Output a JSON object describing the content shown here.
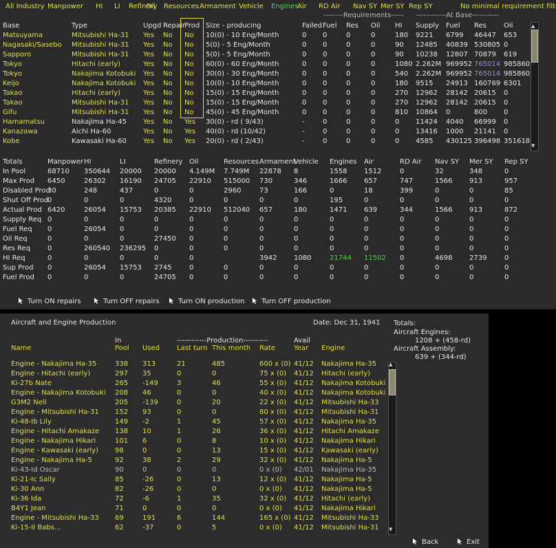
{
  "filters": [
    {
      "label": "All Industry",
      "color": "#e2e23a"
    },
    {
      "label": "Manpower",
      "color": "#e2e23a"
    },
    {
      "label": "HI",
      "color": "#e2e23a"
    },
    {
      "label": "LI",
      "color": "#e2e23a"
    },
    {
      "label": "Refinery",
      "color": "#e2e23a"
    },
    {
      "label": "Oil",
      "color": "#e2e23a"
    },
    {
      "label": "Resources",
      "color": "#e2e23a"
    },
    {
      "label": "Armament",
      "color": "#e2e23a"
    },
    {
      "label": "Vehicle",
      "color": "#e2e23a"
    },
    {
      "label": "Engines",
      "color": "#3ae03a"
    },
    {
      "label": "Air",
      "color": "#e2e23a"
    },
    {
      "label": "RD Air",
      "color": "#e2e23a"
    },
    {
      "label": "Nav SY",
      "color": "#e2e23a"
    },
    {
      "label": "Mer SY",
      "color": "#e2e23a"
    },
    {
      "label": "Rep SY",
      "color": "#e2e23a"
    },
    {
      "label": "No minimal requirement filter",
      "color": "#e2e23a"
    }
  ],
  "group_headers": {
    "requirements": "--------Requirements-----",
    "atbase": "------------At Base-----------"
  },
  "base_headers": [
    "Base",
    "Type",
    "Upgd",
    "Repair",
    "Prod",
    "Size - producing",
    "Failed",
    "Fuel",
    "Res",
    "Oil",
    "HI",
    "Supply",
    "Fuel",
    "Res",
    "Oil"
  ],
  "bases": [
    {
      "c": [
        "Matsuyama",
        "Mitsubishi Ha-31",
        "Yes",
        "No",
        "No",
        "10(0) - 10 Eng/Month",
        "0",
        "0",
        "0",
        "0",
        "180",
        "9221",
        "6799",
        "46447",
        "653"
      ],
      "res_blue": false,
      "style": "yel"
    },
    {
      "c": [
        "Nagasaki/Sasebo",
        "Mitsubishi Ha-31",
        "Yes",
        "No",
        "No",
        "5(0) - 5 Eng/Month",
        "0",
        "0",
        "0",
        "0",
        "90",
        "12485",
        "40839",
        "530805",
        "0"
      ],
      "res_blue": false,
      "style": "yel"
    },
    {
      "c": [
        "Sapporo",
        "Mitsubishi Ha-31",
        "Yes",
        "No",
        "No",
        "5(0) - 5 Eng/Month",
        "0",
        "0",
        "0",
        "0",
        "90",
        "10238",
        "12807",
        "70879",
        "619"
      ],
      "res_blue": false,
      "style": "yel"
    },
    {
      "c": [
        "Tokyo",
        "Hitachi (early)",
        "Yes",
        "No",
        "No",
        "60(0) - 60 Eng/Month",
        "0",
        "0",
        "0",
        "0",
        "1080",
        "2.262M",
        "969952",
        "765014",
        "985860"
      ],
      "res_blue": true,
      "style": "yel"
    },
    {
      "c": [
        "Tokyo",
        "Nakajima Kotobuki",
        "Yes",
        "No",
        "No",
        "30(0) - 30 Eng/Month",
        "0",
        "0",
        "0",
        "0",
        "540",
        "2.262M",
        "969952",
        "765014",
        "985860"
      ],
      "res_blue": true,
      "style": "yel"
    },
    {
      "c": [
        "Keijo",
        "Nakajima Kotobuki",
        "Yes",
        "No",
        "No",
        "10(0) - 10 Eng/Month",
        "0",
        "0",
        "0",
        "0",
        "180",
        "9515",
        "24913",
        "160769",
        "6301"
      ],
      "res_blue": false,
      "style": "yel"
    },
    {
      "c": [
        "Takao",
        "Hitachi (early)",
        "Yes",
        "No",
        "No",
        "15(0) - 15 Eng/Month",
        "0",
        "0",
        "0",
        "0",
        "270",
        "12962",
        "28142",
        "20615",
        "0"
      ],
      "res_blue": false,
      "style": "yel"
    },
    {
      "c": [
        "Takao",
        "Mitsubishi Ha-31",
        "Yes",
        "No",
        "No",
        "15(0) - 15 Eng/Month",
        "0",
        "0",
        "0",
        "0",
        "270",
        "12962",
        "28142",
        "20615",
        "0"
      ],
      "res_blue": false,
      "style": "yel"
    },
    {
      "c": [
        "Gifu",
        "Mitsubishi Ha-31",
        "Yes",
        "No",
        "No",
        "45(0) - 45 Eng/Month",
        "0",
        "0",
        "0",
        "0",
        "810",
        "10864",
        "0",
        "800",
        "0"
      ],
      "res_blue": false,
      "style": "yel"
    },
    {
      "c": [
        "Hamamatsu",
        "Nakajima Ha-45",
        "Yes",
        "No",
        "Yes",
        "30(0) - rd ( 9/43)",
        "-",
        "0",
        "0",
        "0",
        "0",
        "11424",
        "4040",
        "66999",
        "0"
      ],
      "res_blue": false,
      "style": "mix"
    },
    {
      "c": [
        "Kanazawa",
        "Aichi Ha-60",
        "Yes",
        "No",
        "Yes",
        "40(0) - rd (10/42)",
        "-",
        "0",
        "0",
        "0",
        "0",
        "13416",
        "1000",
        "21141",
        "0"
      ],
      "res_blue": false,
      "style": "mix"
    },
    {
      "c": [
        "Kobe",
        "Kawasaki Ha-60",
        "Yes",
        "No",
        "Yes",
        "20(0) - rd ( 2/43)",
        "-",
        "0",
        "0",
        "0",
        "0",
        "4585",
        "430125",
        "396498",
        "351618"
      ],
      "res_blue": false,
      "style": "mix"
    }
  ],
  "totals_headers": [
    "Totals",
    "Manpower",
    "HI",
    "LI",
    "Refinery",
    "Oil",
    "Resources",
    "Armament",
    "Vehicle",
    "Engines",
    "Air",
    "RD Air",
    "Nav SY",
    "Mer SY",
    "Rep SY"
  ],
  "totals": [
    [
      "In Pool",
      "68710",
      "350644",
      "20000",
      "20000",
      "4.149M",
      "7.749M",
      "22878",
      "8",
      "1558",
      "1512",
      "0",
      "32",
      "348",
      "0"
    ],
    [
      "Max Prod",
      "6450",
      "26302",
      "16190",
      "24705",
      "22910",
      "515000",
      "730",
      "346",
      "1666",
      "657",
      "747",
      "1566",
      "913",
      "957"
    ],
    [
      "Disabled Prod",
      "30",
      "248",
      "437",
      "0",
      "0",
      "2960",
      "73",
      "166",
      "0",
      "18",
      "399",
      "0",
      "0",
      "85"
    ],
    [
      "Shut Off Prod",
      "0",
      "0",
      "0",
      "4320",
      "0",
      "0",
      "0",
      "0",
      "195",
      "0",
      "0",
      "0",
      "0",
      "0"
    ],
    [
      "Actual Prod",
      "6420",
      "26054",
      "15753",
      "20385",
      "22910",
      "512040",
      "657",
      "180",
      "1471",
      "639",
      "344",
      "1566",
      "913",
      "872"
    ],
    [
      "Supply Req",
      "0",
      "0",
      "0",
      "0",
      "0",
      "0",
      "0",
      "0",
      "0",
      "0",
      "0",
      "0",
      "0",
      "0"
    ],
    [
      "Fuel Req",
      "0",
      "26054",
      "0",
      "0",
      "0",
      "0",
      "0",
      "0",
      "0",
      "0",
      "0",
      "0",
      "0",
      "0"
    ],
    [
      "Oil Req",
      "0",
      "0",
      "0",
      "27450",
      "0",
      "0",
      "0",
      "0",
      "0",
      "0",
      "0",
      "0",
      "0",
      "0"
    ],
    [
      "Res Req",
      "0",
      "260540",
      "236295",
      "0",
      "0",
      "0",
      "0",
      "0",
      "0",
      "0",
      "0",
      "0",
      "0",
      "0"
    ],
    [
      "HI Req",
      "0",
      "0",
      "0",
      "0",
      "0",
      "3942",
      "1080",
      "21744",
      "11502",
      "0",
      "4698",
      "2739",
      "0"
    ],
    [
      "Sup Prod",
      "0",
      "26054",
      "15753",
      "2745",
      "0",
      "0",
      "0",
      "0",
      "0",
      "0",
      "0",
      "0",
      "0",
      "0"
    ],
    [
      "Fuel Prod",
      "0",
      "0",
      "0",
      "24705",
      "0",
      "0",
      "0",
      "0",
      "0",
      "0",
      "0",
      "0",
      "0",
      "0"
    ]
  ],
  "hi_req_green": [
    "21744",
    "11502"
  ],
  "buttons": [
    "Turn ON repairs",
    "Turn OFF repairs",
    "Turn ON production",
    "Turn OFF production"
  ],
  "production": {
    "title": "Aircraft and Engine Production",
    "date": "Date: Dec 31, 1941",
    "totals_label": "Totals:",
    "engines_label": "Aircraft Engines:",
    "engines_value": "1208 + (458-rd)",
    "assembly_label": "Aircraft Assembly:",
    "assembly_value": "639 + (344-rd)",
    "header_top": {
      "in": "In",
      "production": "------------Production----------",
      "avail": "Avail"
    },
    "headers": [
      "Name",
      "Pool",
      "Used",
      "Last turn",
      "This month",
      "Rate",
      "Year",
      "Engine"
    ],
    "rows": [
      {
        "c": [
          "Engine - Nakajima Ha-35",
          "338",
          "313",
          "21",
          "485",
          "600 x (0)",
          "41/12",
          "Nakajima Ha-35"
        ],
        "style": "yel"
      },
      {
        "c": [
          "Engine - Hitachi (early)",
          "297",
          "35",
          "0",
          "0",
          "75 x (0)",
          "41/12",
          "Hitachi (early)"
        ],
        "style": "yel"
      },
      {
        "c": [
          "Ki-27b Nate",
          "265",
          "-149",
          "3",
          "46",
          "55 x (0)",
          "41/12",
          "Nakajima Kotobuki"
        ],
        "style": "yel"
      },
      {
        "c": [
          "Engine - Nakajima Kotobuki",
          "208",
          "46",
          "0",
          "0",
          "40 x (0)",
          "41/12",
          "Nakajima Kotobuki"
        ],
        "style": "yel"
      },
      {
        "c": [
          "G3M2 Nell",
          "205",
          "-139",
          "0",
          "20",
          "22 x (0)",
          "41/12",
          "Mitsubishi Ha-33"
        ],
        "style": "yel"
      },
      {
        "c": [
          "Engine - Mitsubishi Ha-31",
          "152",
          "93",
          "0",
          "0",
          "80 x (0)",
          "41/12",
          "Mitsubishi Ha-31"
        ],
        "style": "yel"
      },
      {
        "c": [
          "Ki-48-Ib Lily",
          "149",
          "-2",
          "1",
          "45",
          "57 x (0)",
          "41/12",
          "Nakajima Ha-35"
        ],
        "style": "yel"
      },
      {
        "c": [
          "Engine - Hitachi Amakaze",
          "138",
          "10",
          "1",
          "26",
          "36 x (0)",
          "41/12",
          "Hitachi Amakaze"
        ],
        "style": "yel"
      },
      {
        "c": [
          "Engine - Nakajima Hikari",
          "101",
          "6",
          "0",
          "8",
          "10 x (0)",
          "41/12",
          "Nakajima Hikari"
        ],
        "style": "yel"
      },
      {
        "c": [
          "Engine - Kawasaki (early)",
          "98",
          "0",
          "0",
          "13",
          "15 x (0)",
          "41/12",
          "Kawasaki (early)"
        ],
        "style": "yel"
      },
      {
        "c": [
          "Engine - Nakajima Ha-5",
          "92",
          "38",
          "2",
          "29",
          "32 x (0)",
          "41/12",
          "Nakajima Ha-5"
        ],
        "style": "yel"
      },
      {
        "c": [
          "Ki-43-Id Oscar",
          "90",
          "0",
          "0",
          "0",
          "0 x (0)",
          "42/01",
          "Nakajima Ha-35"
        ],
        "style": "gry"
      },
      {
        "c": [
          "Ki-21-Ic Sally",
          "85",
          "-26",
          "0",
          "13",
          "12 x (0)",
          "41/12",
          "Nakajima Ha-5"
        ],
        "style": "yel"
      },
      {
        "c": [
          "Ki-30 Ann",
          "82",
          "-26",
          "0",
          "0",
          "0 x (0)",
          "41/12",
          "Nakajima Ha-5"
        ],
        "style": "yel"
      },
      {
        "c": [
          "Ki-36 Ida",
          "72",
          "-6",
          "1",
          "35",
          "32 x (0)",
          "41/12",
          "Hitachi (early)"
        ],
        "style": "yel"
      },
      {
        "c": [
          "B4Y1 Jean",
          "71",
          "0",
          "0",
          "0",
          "0 x (0)",
          "41/12",
          "Nakajima Hikari"
        ],
        "style": "yel"
      },
      {
        "c": [
          "Engine - Mitsubishi Ha-33",
          "69",
          "191",
          "6",
          "144",
          "165 x (0)",
          "41/12",
          "Mitsubishi Ha-33"
        ],
        "style": "yel"
      },
      {
        "c": [
          "Ki-15-II Babs...",
          "62",
          "-37",
          "0",
          "5",
          "0 x (0)",
          "41/12",
          "Mitsubishi Ha-31"
        ],
        "style": "yel"
      }
    ],
    "back_label": "Back",
    "exit_label": "Exit"
  },
  "icons": {
    "button_icon": "mouse-cursor-icon",
    "scroll_up": "arrow-up-icon",
    "scroll_down": "arrow-down-icon"
  }
}
